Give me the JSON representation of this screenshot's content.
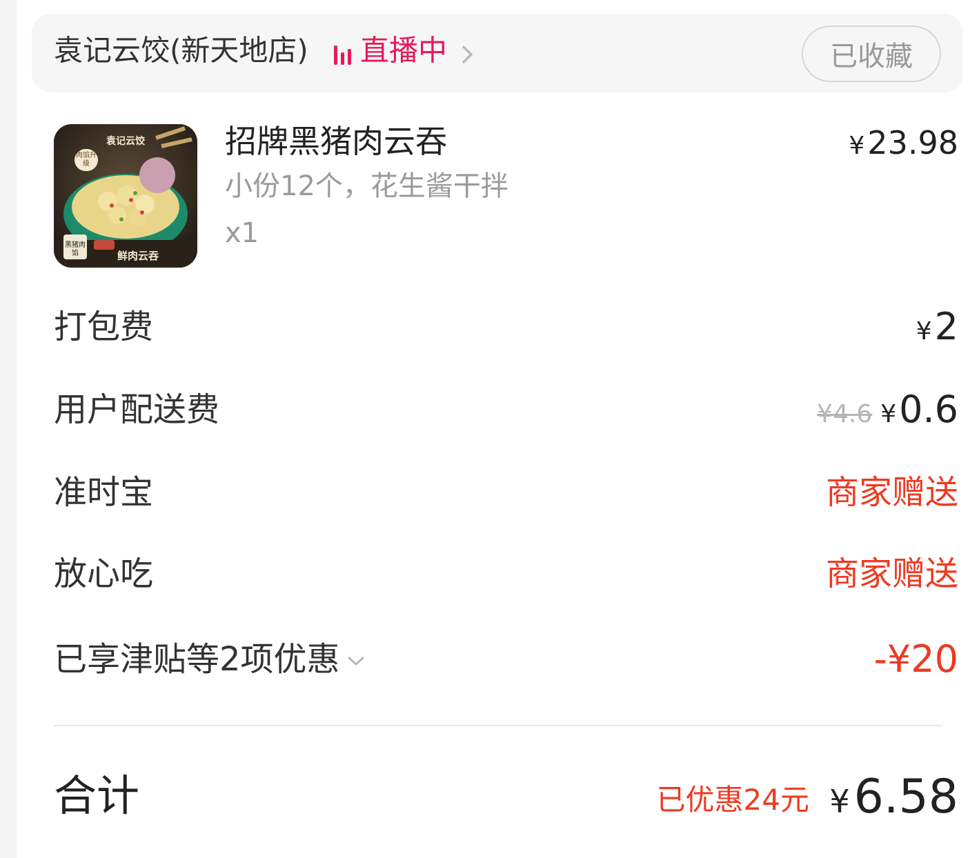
{
  "store": {
    "name": "袁记云饺(新天地店)",
    "live_label": "直播中",
    "favorite_label": "已收藏",
    "live_color": "#e8185a"
  },
  "product": {
    "name": "招牌黑猪肉云吞",
    "spec": "小份12个，花生酱干拌",
    "qty": "x1",
    "currency": "¥",
    "price": "23.98",
    "image_brand": "袁记云饺",
    "image_caption": "鲜肉云吞",
    "image_badge": "肉馅升级",
    "image_tag": "黑猪肉馅"
  },
  "fees": {
    "packing": {
      "label": "打包费",
      "currency": "¥",
      "value": "2"
    },
    "delivery": {
      "label": "用户配送费",
      "original": "¥4.6",
      "currency": "¥",
      "value": "0.6"
    },
    "ontime": {
      "label": "准时宝",
      "value": "商家赠送"
    },
    "safe": {
      "label": "放心吃",
      "value": "商家赠送"
    },
    "discounts": {
      "label": "已享津贴等2项优惠",
      "value": "-¥20"
    }
  },
  "total": {
    "label": "合计",
    "discount_note": "已优惠24元",
    "currency": "¥",
    "value": "6.58"
  },
  "colors": {
    "accent_red": "#ee3a22",
    "live_pink": "#e8185a"
  },
  "icons": {
    "live": "live-bars-icon",
    "chevron_right": "chevron-right-icon",
    "chevron_down": "chevron-down-icon"
  }
}
